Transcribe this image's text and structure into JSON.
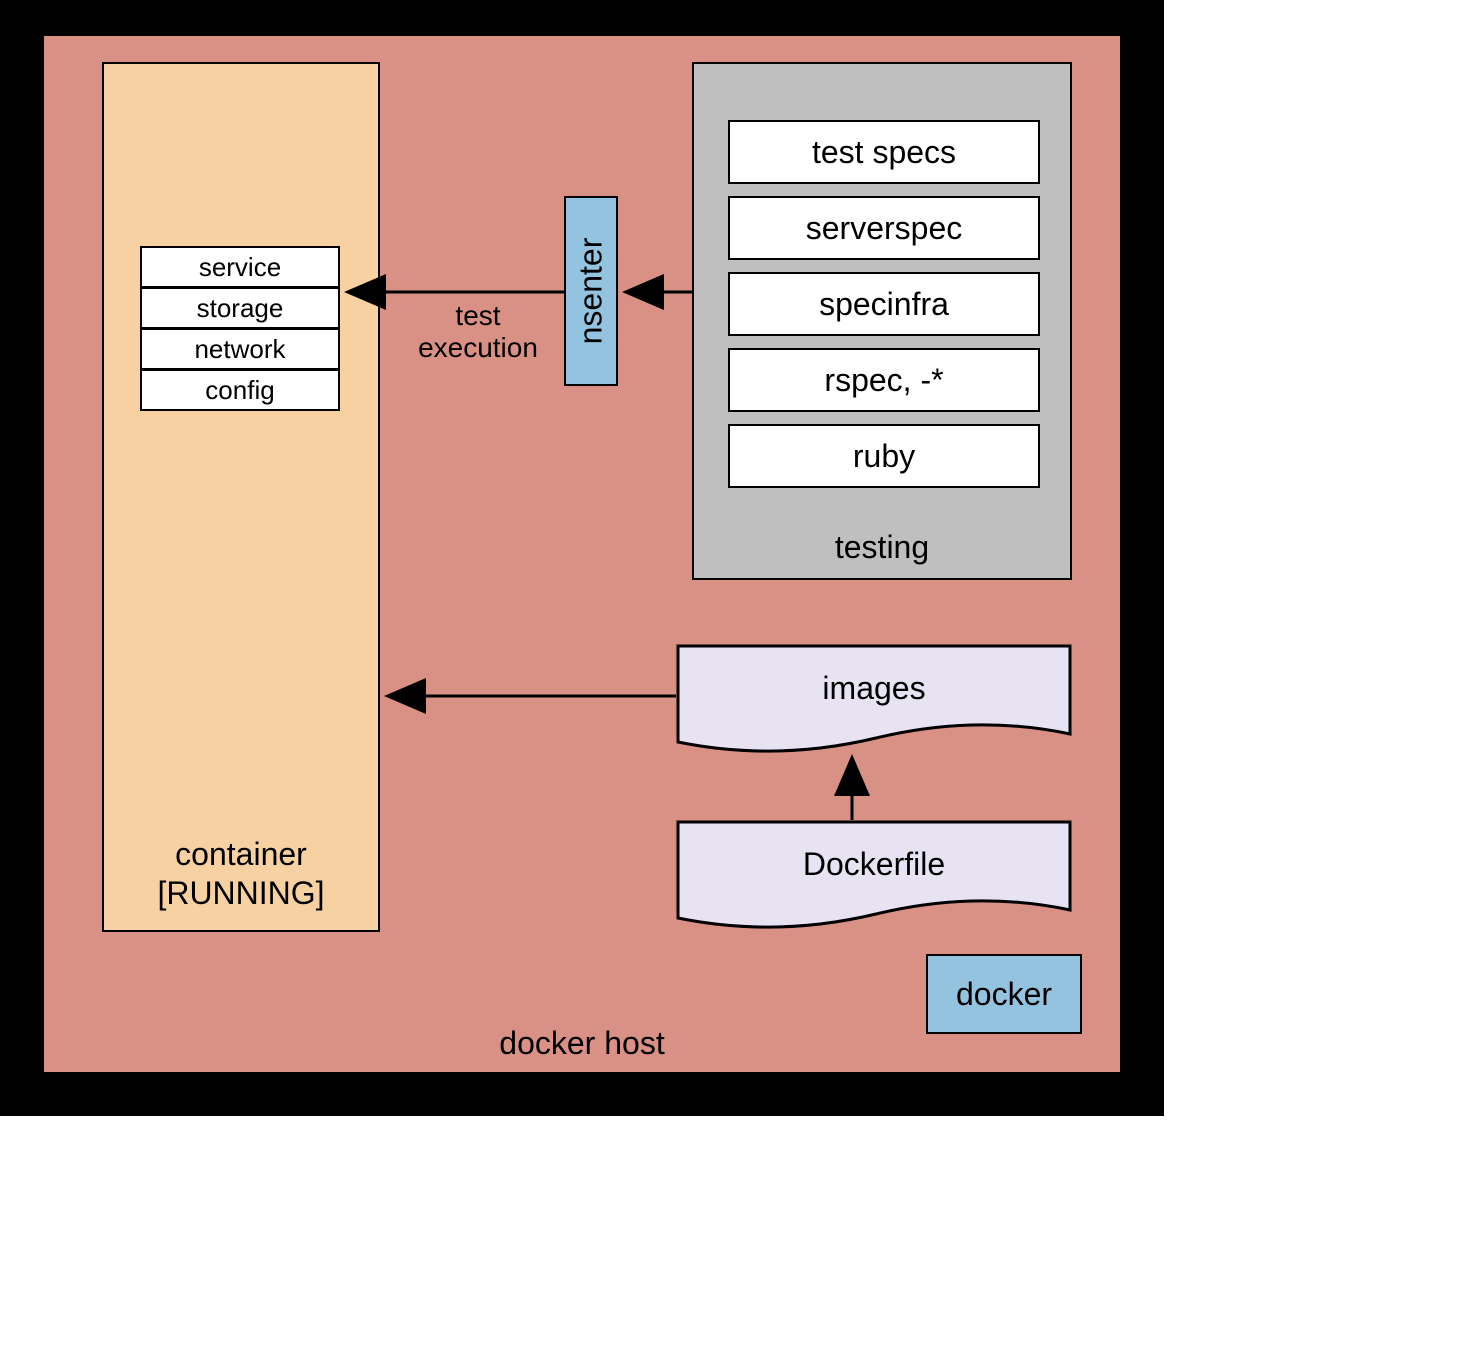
{
  "host": {
    "label": "docker host"
  },
  "container": {
    "label_line1": "container",
    "label_line2": "[RUNNING]",
    "items": [
      "service",
      "storage",
      "network",
      "config"
    ]
  },
  "testing": {
    "label": "testing",
    "items": [
      "test specs",
      "serverspec",
      "specinfra",
      "rspec, -*",
      "ruby"
    ]
  },
  "nsenter": {
    "label": "nsenter"
  },
  "test_execution": {
    "line1": "test",
    "line2": "execution"
  },
  "images_doc": {
    "label": "images"
  },
  "dockerfile_doc": {
    "label": "Dockerfile"
  },
  "docker_box": {
    "label": "docker"
  },
  "colors": {
    "host_bg": "#d99185",
    "container_bg": "#f8d1a2",
    "testing_bg": "#bfbfbf",
    "blue_box": "#93c3df",
    "doc_fill": "#e7e3f3"
  }
}
